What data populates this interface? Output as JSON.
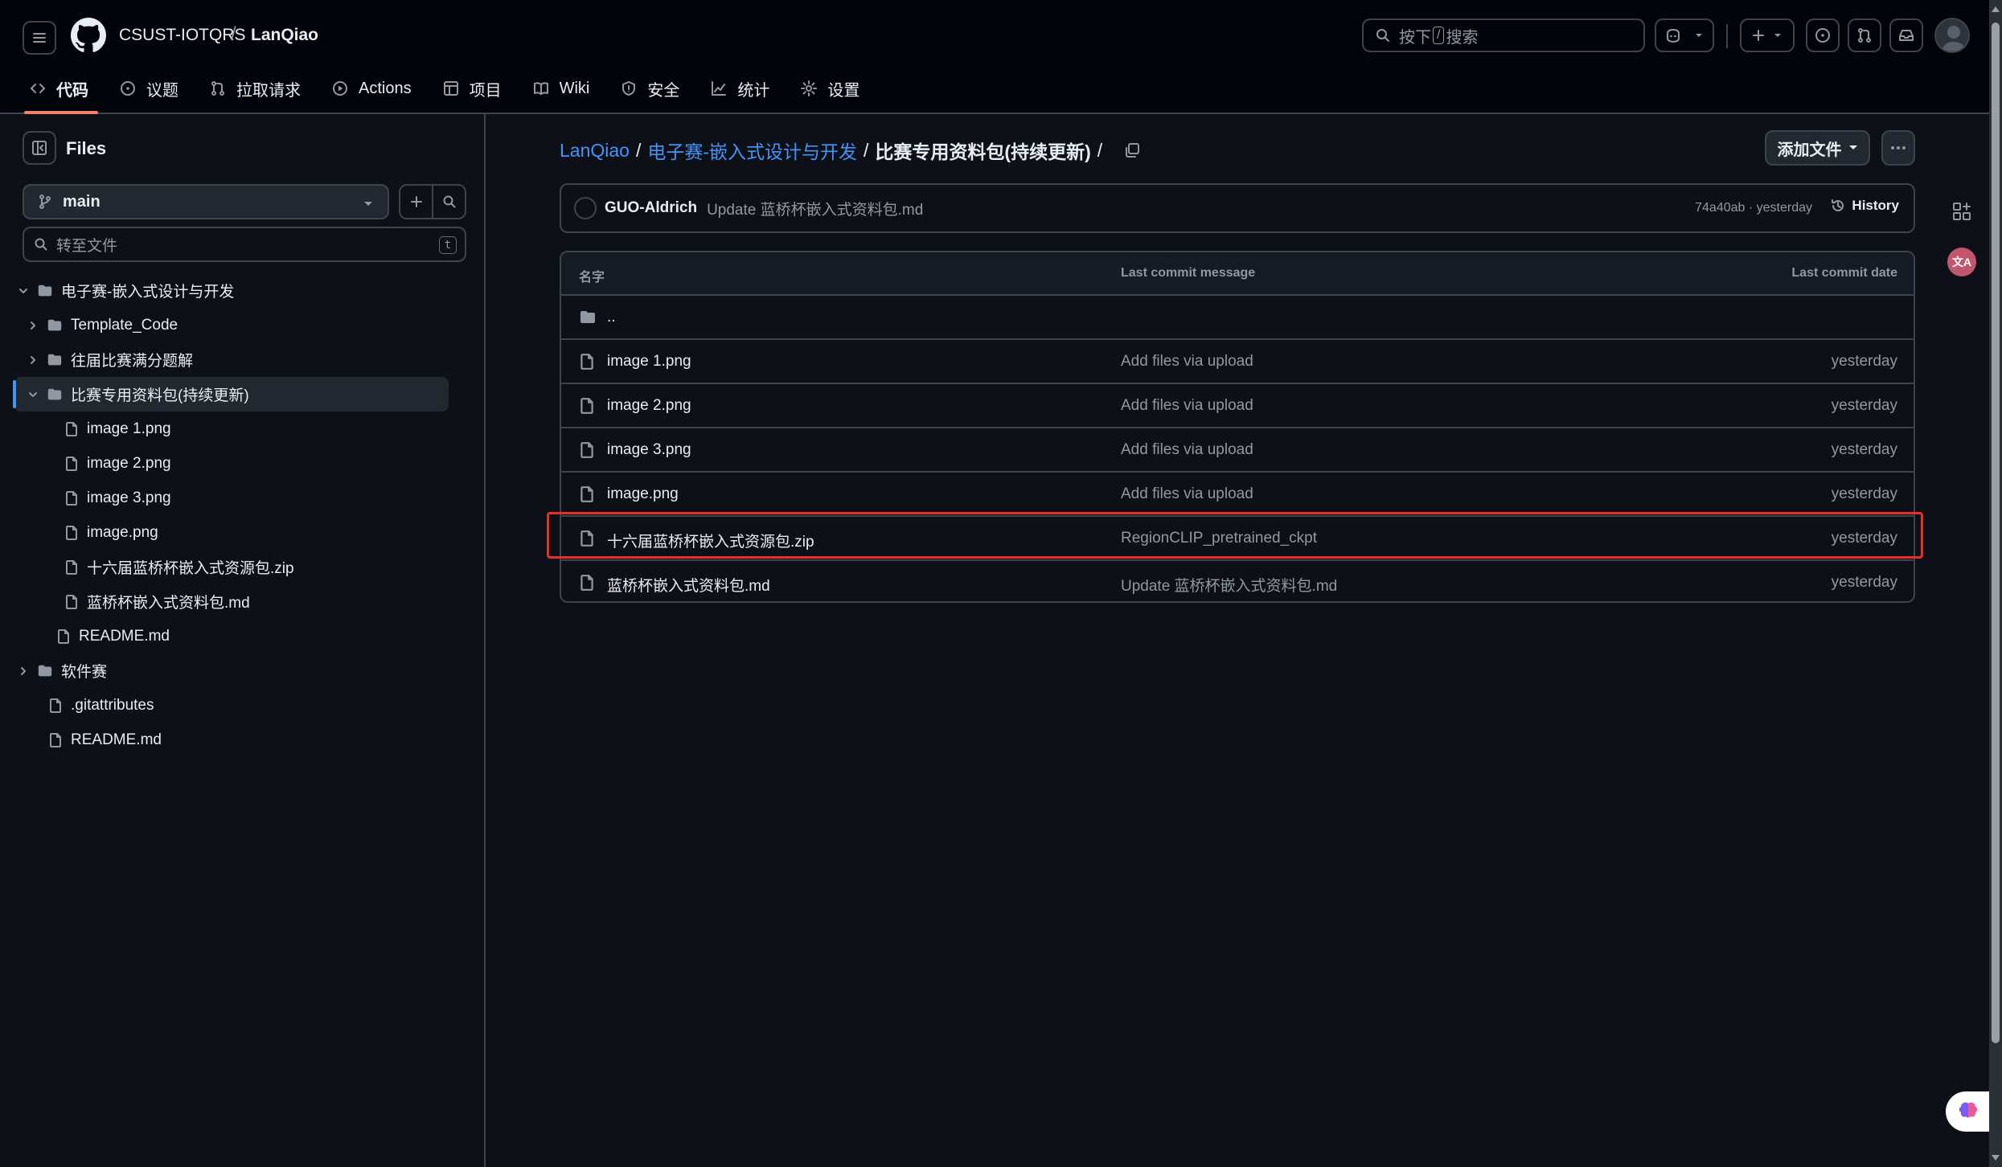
{
  "header": {
    "owner": "CSUST-IOTQRS",
    "separator": "/",
    "repo": "LanQiao",
    "search_prefix": "按下",
    "search_key": "/",
    "search_suffix": "搜索"
  },
  "repo_nav": [
    {
      "label": "代码",
      "icon": "code-icon",
      "active": true
    },
    {
      "label": "议题",
      "icon": "issue-icon"
    },
    {
      "label": "拉取请求",
      "icon": "pull-request-icon"
    },
    {
      "label": "Actions",
      "icon": "play-icon"
    },
    {
      "label": "项目",
      "icon": "table-icon"
    },
    {
      "label": "Wiki",
      "icon": "book-icon"
    },
    {
      "label": "安全",
      "icon": "shield-icon"
    },
    {
      "label": "统计",
      "icon": "graph-icon"
    },
    {
      "label": "设置",
      "icon": "gear-icon"
    }
  ],
  "sidebar": {
    "title": "Files",
    "branch": "main",
    "goto_placeholder": "转至文件",
    "goto_key": "t",
    "tree": [
      {
        "label": "电子赛-嵌入式设计与开发",
        "type": "folder",
        "depth": 0,
        "expanded": true
      },
      {
        "label": "Template_Code",
        "type": "folder",
        "depth": 1,
        "expanded": false
      },
      {
        "label": "往届比赛满分题解",
        "type": "folder",
        "depth": 1,
        "expanded": false
      },
      {
        "label": "比赛专用资料包(持续更新)",
        "type": "folder",
        "depth": 1,
        "expanded": true,
        "selected": true
      },
      {
        "label": "image 1.png",
        "type": "file",
        "depth": 2
      },
      {
        "label": "image 2.png",
        "type": "file",
        "depth": 2
      },
      {
        "label": "image 3.png",
        "type": "file",
        "depth": 2
      },
      {
        "label": "image.png",
        "type": "file",
        "depth": 2
      },
      {
        "label": "十六届蓝桥杯嵌入式资源包.zip",
        "type": "file",
        "depth": 2
      },
      {
        "label": "蓝桥杯嵌入式资料包.md",
        "type": "file",
        "depth": 2
      },
      {
        "label": "README.md",
        "type": "file",
        "depth": 1
      },
      {
        "label": "软件赛",
        "type": "folder",
        "depth": 0,
        "expanded": false
      },
      {
        "label": ".gitattributes",
        "type": "file",
        "depth": 0
      },
      {
        "label": "README.md",
        "type": "file",
        "depth": 0
      }
    ]
  },
  "breadcrumb": {
    "root": "LanQiao",
    "parent": "电子赛-嵌入式设计与开发",
    "current": "比赛专用资料包(持续更新)",
    "slash": "/"
  },
  "actions": {
    "add_file": "添加文件"
  },
  "commit": {
    "author": "GUO-Aldrich",
    "message": "Update 蓝桥杯嵌入式资料包.md",
    "meta": "74a40ab · yesterday",
    "history": "History"
  },
  "table": {
    "col_name": "名字",
    "col_message": "Last commit message",
    "col_date": "Last commit date",
    "parent_dir": "..",
    "rows": [
      {
        "name": "image 1.png",
        "message": "Add files via upload",
        "date": "yesterday"
      },
      {
        "name": "image 2.png",
        "message": "Add files via upload",
        "date": "yesterday"
      },
      {
        "name": "image 3.png",
        "message": "Add files via upload",
        "date": "yesterday"
      },
      {
        "name": "image.png",
        "message": "Add files via upload",
        "date": "yesterday"
      },
      {
        "name": "十六届蓝桥杯嵌入式资源包.zip",
        "message": "RegionCLIP_pretrained_ckpt",
        "date": "yesterday",
        "highlighted": true
      },
      {
        "name": "蓝桥杯嵌入式资料包.md",
        "message": "Update 蓝桥杯嵌入式资料包.md",
        "date": "yesterday"
      }
    ]
  },
  "right_rail": {
    "translate_badge": "文A"
  },
  "colors": {
    "background": "#0d1117",
    "header_bg": "#010409",
    "border": "#3d444d",
    "link": "#4493f8",
    "muted": "#9198a1",
    "active_tab": "#f78166",
    "highlight_box": "#e5302a"
  }
}
